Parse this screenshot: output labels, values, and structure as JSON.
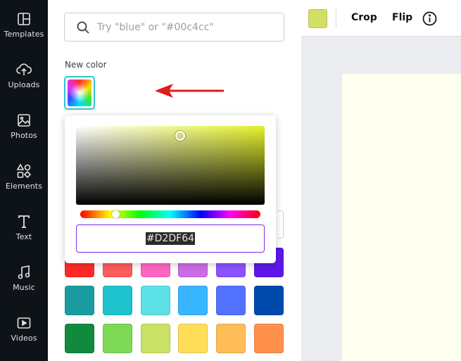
{
  "sidebar": {
    "items": [
      {
        "label": "Templates",
        "icon": "templates-icon"
      },
      {
        "label": "Uploads",
        "icon": "upload-cloud-icon"
      },
      {
        "label": "Photos",
        "icon": "photo-icon"
      },
      {
        "label": "Elements",
        "icon": "shapes-icon"
      },
      {
        "label": "Text",
        "icon": "text-icon"
      },
      {
        "label": "Music",
        "icon": "music-note-icon"
      },
      {
        "label": "Videos",
        "icon": "video-icon"
      }
    ]
  },
  "search": {
    "placeholder": "Try \"blue\" or \"#00c4cc\""
  },
  "color_panel": {
    "new_color_label": "New color",
    "picker": {
      "hex_value": "#D2DF64"
    },
    "swatches": [
      [
        "#ff2a2a",
        "#ff5c5c",
        "#ff66c4",
        "#cb6ce6",
        "#8c52ff",
        "#5e17eb"
      ],
      [
        "#1a9ba1",
        "#1ec3ce",
        "#5ce1e6",
        "#38b6ff",
        "#5271ff",
        "#004aad"
      ],
      [
        "#128a3e",
        "#7ed957",
        "#c9e265",
        "#ffde59",
        "#ffbd59",
        "#ff914d"
      ]
    ]
  },
  "toolbar": {
    "color": "#d2df64",
    "crop_label": "Crop",
    "flip_label": "Flip",
    "info_icon": "info-icon"
  },
  "colors": {
    "rail_bg": "#0e1318",
    "accent_border": "#2ec4d0",
    "hex_border": "#7d2ae8",
    "page_bg": "#fffff0"
  }
}
